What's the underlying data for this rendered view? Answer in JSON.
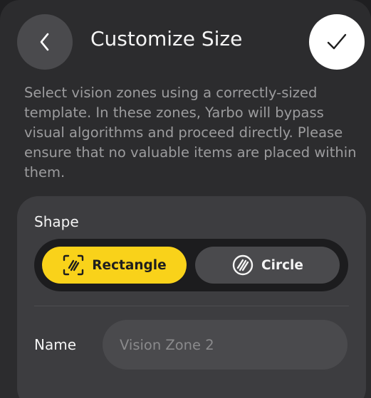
{
  "header": {
    "title": "Customize Size",
    "back_icon": "chevron-left-icon",
    "confirm_icon": "checkmark-icon"
  },
  "description": "Select vision zones using a correctly-sized template. In these zones, Yarbo will bypass visual algorithms and proceed directly. Please ensure that no valuable items are placed within them.",
  "shape": {
    "label": "Shape",
    "options": [
      {
        "label": "Rectangle",
        "icon": "rectangle-hatch-icon",
        "selected": true
      },
      {
        "label": "Circle",
        "icon": "circle-hatch-icon",
        "selected": false
      }
    ]
  },
  "name": {
    "label": "Name",
    "value": "",
    "placeholder": "Vision Zone 2"
  },
  "colors": {
    "accent": "#f9d21a",
    "panel": "#2c2c2e",
    "card": "#3d3d40"
  }
}
